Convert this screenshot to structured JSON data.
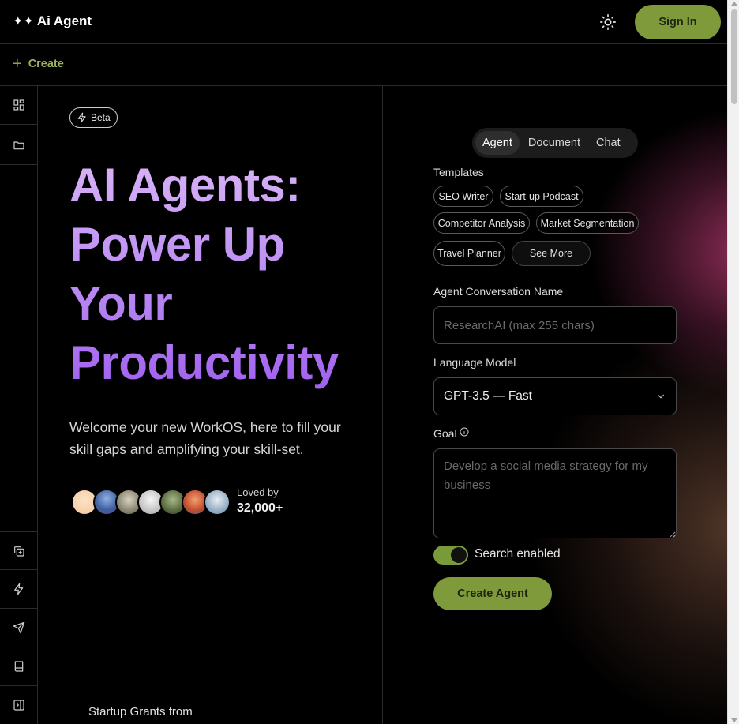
{
  "header": {
    "logo_icon": "sparkles-icon",
    "logo_stars": "✦✦",
    "app_name": "Ai Agent",
    "theme_icon": "sun-icon",
    "sign_in_label": "Sign In"
  },
  "createbar": {
    "create_label": "Create"
  },
  "sidebar": {
    "top_items": [
      {
        "icon": "grid-icon"
      },
      {
        "icon": "folder-icon"
      }
    ],
    "bottom_items": [
      {
        "icon": "copy-plus-icon"
      },
      {
        "icon": "lightning-icon"
      },
      {
        "icon": "send-icon"
      },
      {
        "icon": "book-icon"
      },
      {
        "icon": "panel-collapse-icon"
      }
    ]
  },
  "hero": {
    "badge": "Beta",
    "title_lines": [
      "AI Agents:",
      "Power Up",
      "Your",
      "Productivity"
    ],
    "subtitle": "Welcome your new WorkOS, here to fill your skill gaps and amplifying your skill-set.",
    "loved_by": "Loved by",
    "loved_count": "32,000+",
    "startup_text": "Startup Grants from"
  },
  "form": {
    "tabs": [
      "Agent",
      "Document",
      "Chat"
    ],
    "active_tab": "Agent",
    "templates_label": "Templates",
    "templates": [
      "SEO Writer",
      "Start-up Podcast",
      "Competitor Analysis",
      "Market Segmentation",
      "Travel Planner"
    ],
    "see_more": "See More",
    "name_label": "Agent Conversation Name",
    "name_placeholder": "ResearchAI (max 255 chars)",
    "model_label": "Language Model",
    "model_value": "GPT-3.5 — Fast",
    "goal_label": "Goal",
    "goal_placeholder": "Develop a social media strategy for my business",
    "search_label": "Search enabled",
    "search_enabled": true,
    "create_label": "Create Agent"
  },
  "colors": {
    "accent": "#7f9a3a",
    "hero_gradient_start": "#d9b4f7",
    "hero_gradient_end": "#a060ef"
  }
}
